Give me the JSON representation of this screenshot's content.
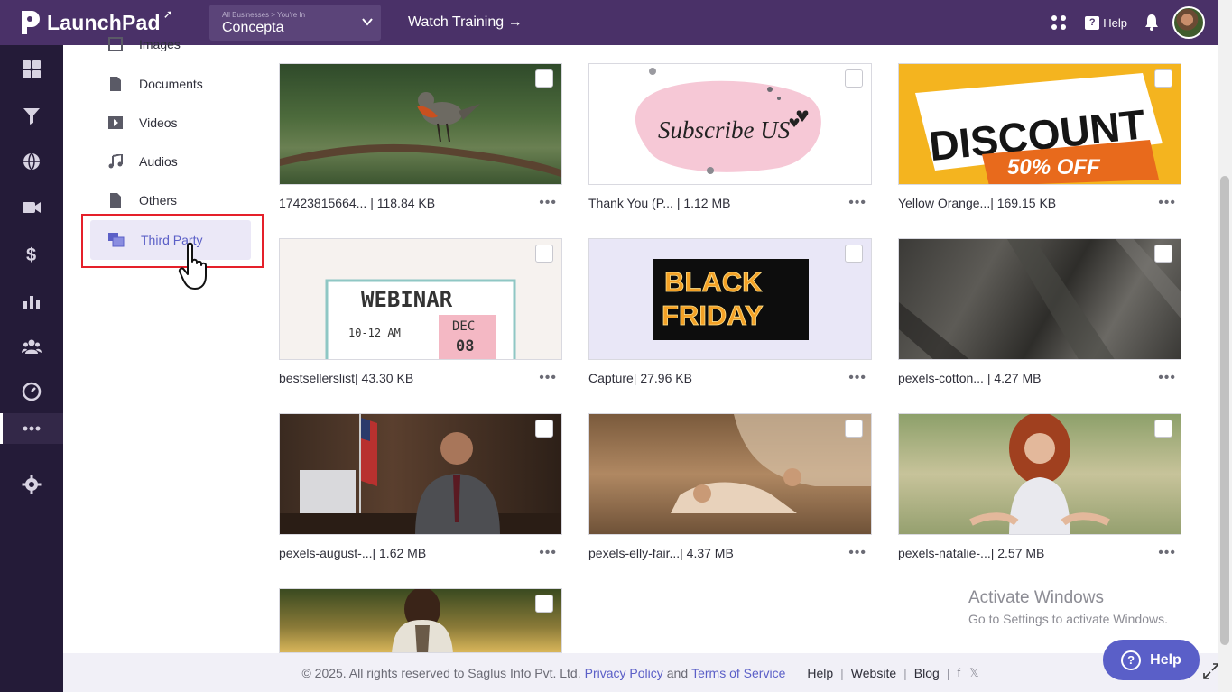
{
  "header": {
    "app_name": "LaunchPad",
    "business_crumb": "All Businesses > You're In",
    "business_name": "Concepta",
    "watch_training": "Watch Training →",
    "help_label": "Help"
  },
  "sidebar_icons": [
    "dashboard-icon",
    "funnel-icon",
    "globe-icon",
    "video-camera-icon",
    "dollar-icon",
    "analytics-icon",
    "people-icon",
    "gauge-icon",
    "more-icon",
    "settings-icon"
  ],
  "subnav": {
    "items": [
      {
        "label": "Images"
      },
      {
        "label": "Documents"
      },
      {
        "label": "Videos"
      },
      {
        "label": "Audios"
      },
      {
        "label": "Others"
      },
      {
        "label": "Third Party"
      }
    ]
  },
  "media": [
    {
      "name": "17423815664... | 118.84 KB"
    },
    {
      "name": "Thank You (P... | 1.12 MB",
      "overlay": "Subscribe US"
    },
    {
      "name": "Yellow Orange...| 169.15 KB",
      "overlay1": "DISCOUNT",
      "overlay2": "50% OFF"
    },
    {
      "name": "bestsellerslist| 43.30 KB",
      "overlay1": "WEBINAR",
      "overlay2": "10-12 AM",
      "overlay3": "DEC",
      "overlay4": "08"
    },
    {
      "name": "Capture| 27.96 KB",
      "overlay1": "BLACK",
      "overlay2": "FRIDAY"
    },
    {
      "name": "pexels-cotton... | 4.27 MB"
    },
    {
      "name": "pexels-august-...| 1.62 MB"
    },
    {
      "name": "pexels-elly-fair...| 4.37 MB"
    },
    {
      "name": "pexels-natalie-...| 2.57 MB"
    },
    {
      "name": ""
    }
  ],
  "footer": {
    "copyright": "© 2025. All rights reserved to Saglus Info Pvt. Ltd.",
    "privacy": "Privacy Policy",
    "and": "and",
    "terms": "Terms of Service",
    "help": "Help",
    "website": "Website",
    "blog": "Blog",
    "sep": "|"
  },
  "watermark": {
    "line1": "Activate Windows",
    "line2": "Go to Settings to activate Windows."
  },
  "help_button": "Help",
  "colors": {
    "topbar": "#4a3168",
    "leftnav": "#241b38",
    "accent": "#5b5fc7",
    "highlight_box": "#e5202a"
  }
}
